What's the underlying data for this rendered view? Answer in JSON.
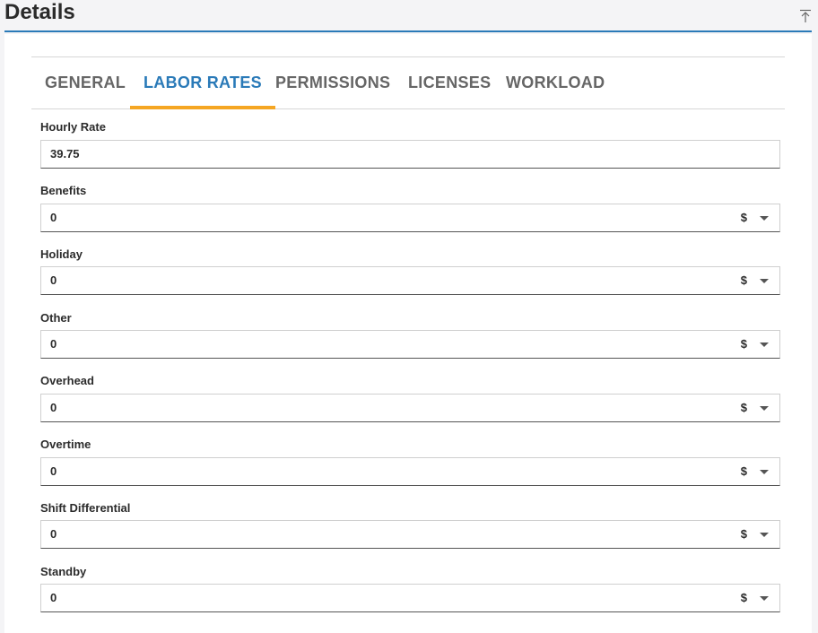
{
  "header": {
    "title": "Details"
  },
  "tabs": [
    {
      "label": "GENERAL"
    },
    {
      "label": "LABOR RATES"
    },
    {
      "label": "PERMISSIONS"
    },
    {
      "label": "LICENSES"
    },
    {
      "label": "WORKLOAD"
    }
  ],
  "form": {
    "hourly_rate": {
      "label": "Hourly Rate",
      "value": "39.75"
    },
    "benefits": {
      "label": "Benefits",
      "value": "0",
      "unit": "$"
    },
    "holiday": {
      "label": "Holiday",
      "value": "0",
      "unit": "$"
    },
    "other": {
      "label": "Other",
      "value": "0",
      "unit": "$"
    },
    "overhead": {
      "label": "Overhead",
      "value": "0",
      "unit": "$"
    },
    "overtime": {
      "label": "Overtime",
      "value": "0",
      "unit": "$"
    },
    "shift_differential": {
      "label": "Shift Differential",
      "value": "0",
      "unit": "$"
    },
    "standby": {
      "label": "Standby",
      "value": "0",
      "unit": "$"
    }
  },
  "colors": {
    "accent": "#2a7ab8",
    "tab_indicator": "#f5a623"
  }
}
